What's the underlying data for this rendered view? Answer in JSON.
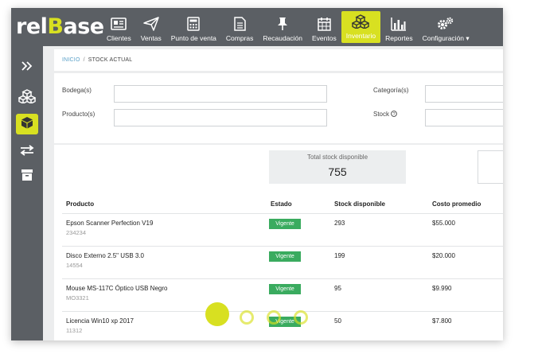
{
  "brand": {
    "logo_prefix": "rel",
    "logo_b": "B",
    "logo_suffix": "ase",
    "accent": "#d8e021",
    "bar": "#5b5f64"
  },
  "nav": {
    "items": [
      {
        "label": "Clientes",
        "icon": "id-card-icon"
      },
      {
        "label": "Ventas",
        "icon": "paper-plane-icon"
      },
      {
        "label": "Punto de venta",
        "icon": "calculator-icon"
      },
      {
        "label": "Compras",
        "icon": "document-icon"
      },
      {
        "label": "Recaudación",
        "icon": "pin-icon"
      },
      {
        "label": "Eventos",
        "icon": "calendar-icon"
      },
      {
        "label": "Inventario",
        "icon": "boxes-icon",
        "active": true
      },
      {
        "label": "Reportes",
        "icon": "bar-chart-icon"
      },
      {
        "label": "Configuración",
        "icon": "gears-icon",
        "dropdown": true
      }
    ]
  },
  "sidebar": {
    "items": [
      "expand-icon",
      "boxes-stack-icon",
      "box-icon",
      "transfer-arrows-icon",
      "archive-icon"
    ],
    "active_index": 2
  },
  "breadcrumb": {
    "home": "INICIO",
    "separator": "/",
    "current": "STOCK ACTUAL"
  },
  "filters": {
    "bodega_label": "Bodega(s)",
    "producto_label": "Producto(s)",
    "categoria_label": "Categoría(s)",
    "stock_label": "Stock"
  },
  "summary": {
    "total_label": "Total stock disponible",
    "total_value": "755"
  },
  "table": {
    "headers": {
      "producto": "Producto",
      "estado": "Estado",
      "stock": "Stock disponible",
      "costo": "Costo promedio"
    },
    "rows": [
      {
        "name": "Epson Scanner Perfection V19",
        "code": "234234",
        "status": "Vigente",
        "stock": "293",
        "cost": "$55.000"
      },
      {
        "name": "Disco Externo 2.5\" USB 3.0",
        "code": "14554",
        "status": "Vigente",
        "stock": "199",
        "cost": "$20.000"
      },
      {
        "name": "Mouse MS-117C Óptico USB Negro",
        "code": "MO3321",
        "status": "Vigente",
        "stock": "95",
        "cost": "$9.990"
      },
      {
        "name": "Licencia Win10 xp 2017",
        "code": "11312",
        "status": "Vigente",
        "stock": "50",
        "cost": "$7.800"
      }
    ]
  }
}
